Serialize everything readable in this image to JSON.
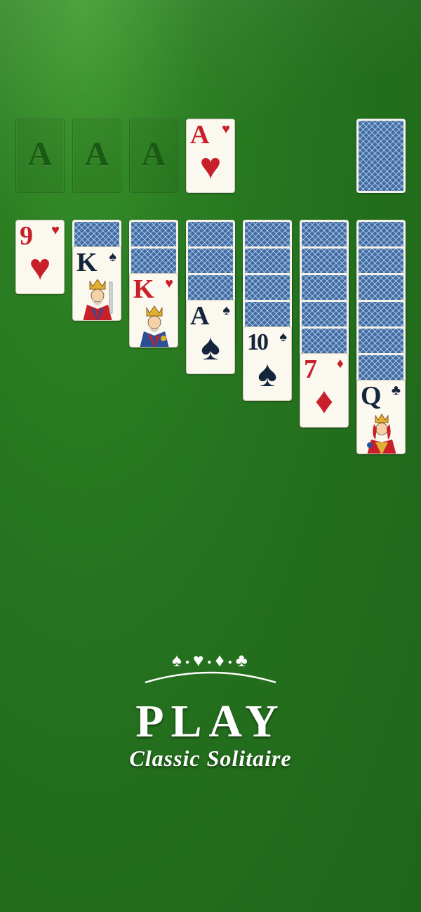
{
  "foundations": [
    {
      "label": "A"
    },
    {
      "label": "A"
    },
    {
      "label": "A"
    },
    {
      "rank": "A",
      "suit": "♥"
    }
  ],
  "stock": {
    "state": "face-down"
  },
  "tableau": [
    {
      "face_down": 0,
      "rank": "9",
      "suit": "♥"
    },
    {
      "face_down": 1,
      "rank": "K",
      "suit": "♠"
    },
    {
      "face_down": 2,
      "rank": "K",
      "suit": "♥"
    },
    {
      "face_down": 3,
      "rank": "A",
      "suit": "♠"
    },
    {
      "face_down": 4,
      "rank": "10",
      "suit": "♠"
    },
    {
      "face_down": 5,
      "rank": "7",
      "suit": "♦"
    },
    {
      "face_down": 6,
      "rank": "Q",
      "suit": "♣"
    }
  ],
  "title": {
    "suits": [
      "♠",
      "♥",
      "♦",
      "♣"
    ],
    "play_label": "PLAY",
    "subtitle": "Classic Solitaire"
  },
  "colors": {
    "felt": "#2b7d22",
    "red_suit": "#c8202a",
    "black_suit": "#14243a",
    "card_back": "#3f6da7"
  }
}
